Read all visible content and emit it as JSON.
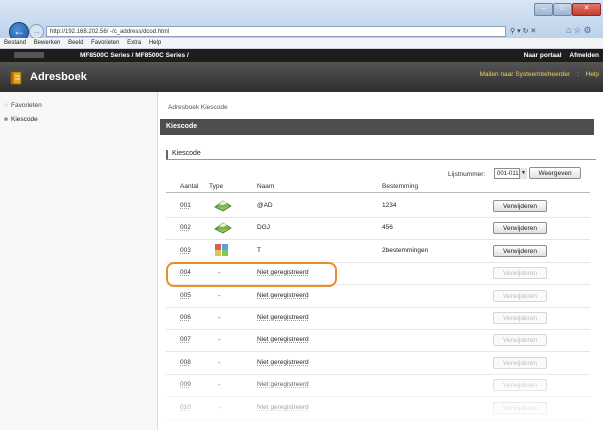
{
  "browser": {
    "address": "http://192.168.202.56/ -/c_address/dcod.html",
    "window_controls": [
      "minimize-icon",
      "maximize-icon",
      "close-icon"
    ]
  },
  "menu": [
    "Bestand",
    "Bewerken",
    "Beeld",
    "Favorieten",
    "Extra",
    "Help"
  ],
  "device_bar": {
    "title": "MF8500C Series / MF8500C Series /",
    "links": [
      "Naar portaal",
      "Afmelden"
    ]
  },
  "header": {
    "title": "Adresboek",
    "links": [
      "Mailen naar Systeembeheerder",
      "Help"
    ],
    "link_sep": ":"
  },
  "sidebar": {
    "items": [
      {
        "label": "Favorieten",
        "marker": "○"
      },
      {
        "label": "Kiescode",
        "marker": "■"
      }
    ]
  },
  "breadcrumb": "Adresboek Kiescode",
  "section_title": "Kiescode",
  "panel_title": "Kiescode",
  "list": {
    "label": "Lijstnummer:",
    "selected": "001-011",
    "display_button": "Weergeven"
  },
  "table": {
    "headers": [
      "Aantal",
      "Type",
      "Naam",
      "Bestemming"
    ],
    "rows": [
      {
        "num": "001",
        "type": "email-icon",
        "name": "@AD",
        "dest": "1234",
        "button": "Verwijderen",
        "enabled": true
      },
      {
        "num": "002",
        "type": "email-icon",
        "name": "DGJ",
        "dest": "456",
        "button": "Verwijderen",
        "enabled": true
      },
      {
        "num": "003",
        "type": "group-icon",
        "name": "T",
        "dest": "2bestemmingen",
        "button": "Verwijderen",
        "enabled": true
      },
      {
        "num": "004",
        "type": "-",
        "name": "Niet geregistreerd",
        "dest": "",
        "button": "Verwijderen",
        "enabled": false
      },
      {
        "num": "005",
        "type": "-",
        "name": "Niet geregistreerd",
        "dest": "",
        "button": "Verwijderen",
        "enabled": false
      },
      {
        "num": "006",
        "type": "-",
        "name": "Niet geregistreerd",
        "dest": "",
        "button": "Verwijderen",
        "enabled": false
      },
      {
        "num": "007",
        "type": "-",
        "name": "Niet geregistreerd",
        "dest": "",
        "button": "Verwijderen",
        "enabled": false
      },
      {
        "num": "008",
        "type": "-",
        "name": "Niet geregistreerd",
        "dest": "",
        "button": "Verwijderen",
        "enabled": false
      },
      {
        "num": "009",
        "type": "-",
        "name": "Niet geregistreerd",
        "dest": "",
        "button": "Verwijderen",
        "enabled": false
      },
      {
        "num": "010",
        "type": "-",
        "name": "Niet geregistreerd",
        "dest": "",
        "button": "Verwijderen",
        "enabled": false
      }
    ]
  },
  "colors": {
    "highlight": "#e88f2a",
    "header_bg": "#3a3a3a",
    "device_bar_bg": "#1d1d1d",
    "header_link": "#f0d060"
  }
}
